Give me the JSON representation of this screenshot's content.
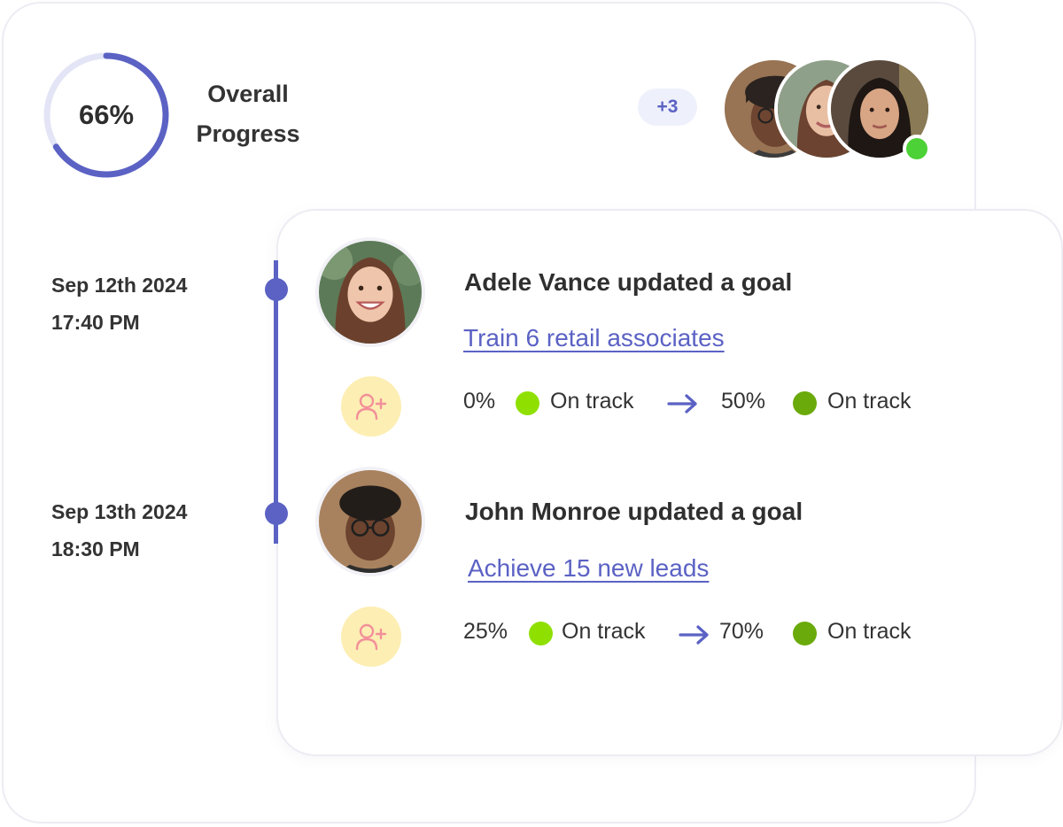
{
  "overall": {
    "percent_label": "66%",
    "progress": 0.66,
    "title_line1": "Overall",
    "title_line2": "Progress",
    "ring_color": "#5b62c4",
    "track_color": "#e3e5f6"
  },
  "team": {
    "extra_count": "+3",
    "online_color": "#4cd137"
  },
  "events": [
    {
      "date": "Sep 12th 2024",
      "time": "17:40 PM",
      "title": "Adele Vance updated a goal",
      "goal": "Train 6 retail associates",
      "from_value": "0%",
      "from_status": "On track",
      "to_value": "50%",
      "to_status": "On track"
    },
    {
      "date": "Sep 13th 2024",
      "time": "18:30 PM",
      "title": "John Monroe updated a goal",
      "goal": "Achieve 15 new leads",
      "from_value": "25%",
      "from_status": "On track",
      "to_value": "70%",
      "to_status": "On track"
    }
  ],
  "colors": {
    "accent": "#5b62c4",
    "status_light": "#8fe000",
    "status_dark": "#6aaa0a",
    "icon_bg": "#fdeeb3",
    "icon_fg": "#f2909a"
  },
  "icons": {
    "event_icon": "add-user-icon",
    "arrow_icon": "arrow-right-icon"
  }
}
